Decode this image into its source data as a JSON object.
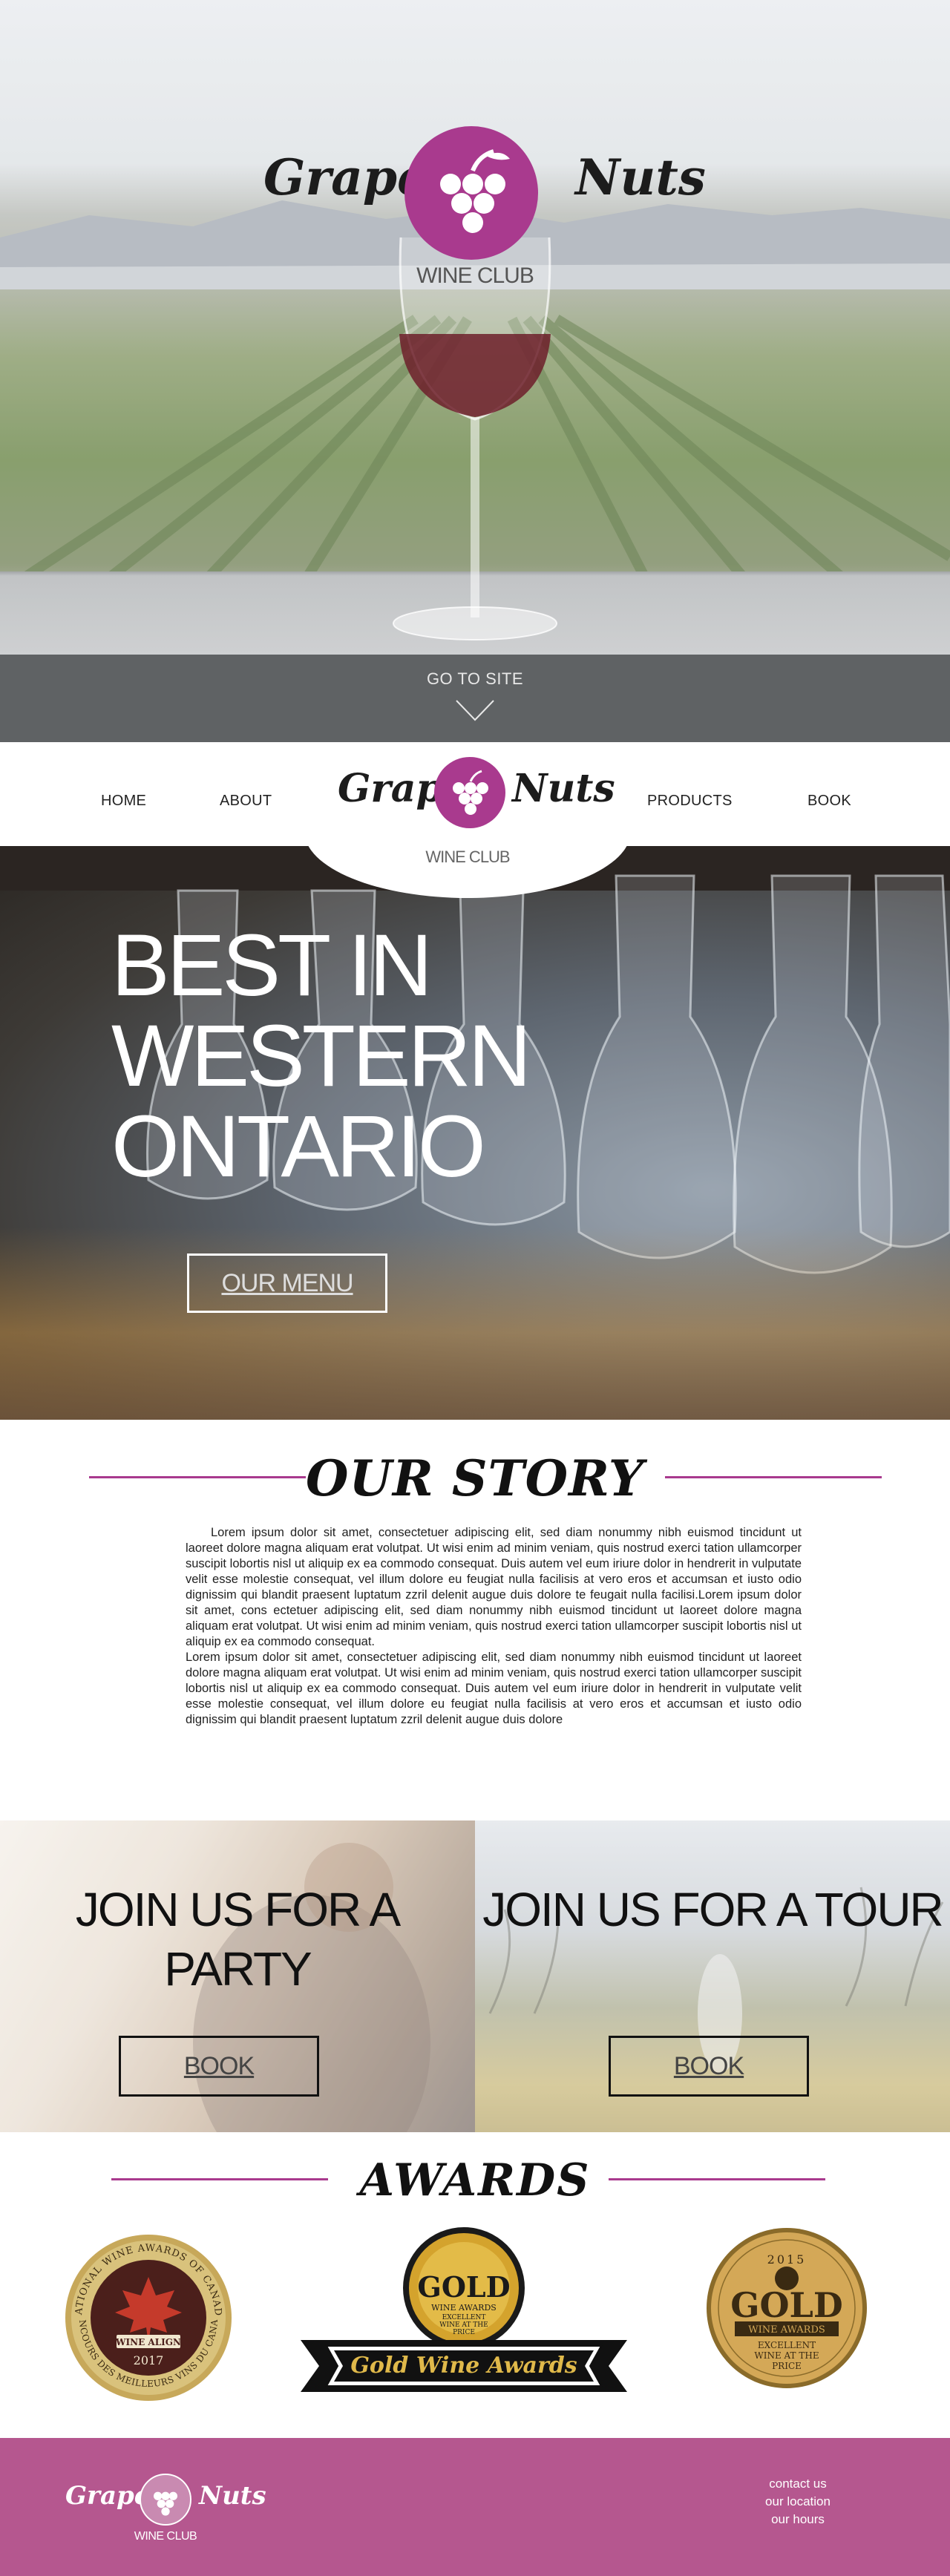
{
  "hero": {
    "brand_left": "Grape",
    "brand_right": "Nuts",
    "brand_sub": "WINE CLUB",
    "goto_label": "GO TO SITE"
  },
  "nav": {
    "items": [
      {
        "label": "HOME"
      },
      {
        "label": "ABOUT"
      },
      {
        "label": "PRODUCTS"
      },
      {
        "label": "BOOK"
      }
    ],
    "brand_left": "Grape",
    "brand_right": "Nuts",
    "brand_sub": "WINE CLUB"
  },
  "bar_hero": {
    "headline": "BEST IN WESTERN ONTARIO",
    "menu_button": "OUR MENU"
  },
  "story": {
    "title": "OUR STORY",
    "paragraph1": "Lorem ipsum dolor sit amet, consectetuer adipiscing elit, sed diam nonummy nibh euismod tincidunt ut laoreet dolore magna aliquam erat volutpat. Ut wisi enim ad minim veniam, quis nostrud exerci tation ullamcorper suscipit lobortis nisl ut aliquip ex ea commodo consequat. Duis autem vel eum iriure dolor in hendrerit in vulputate velit esse molestie consequat, vel illum dolore eu feugiat nulla facilisis at vero eros et accumsan et iusto odio dignissim qui blandit praesent luptatum zzril delenit augue duis dolore te feugait nulla facilisi.Lorem ipsum dolor sit amet, cons ectetuer adipiscing elit, sed diam nonummy nibh euismod tincidunt ut laoreet dolore magna aliquam erat volutpat. Ut wisi enim ad minim veniam, quis nostrud exerci tation ullamcorper suscipit lobortis nisl ut aliquip ex ea commodo consequat.",
    "paragraph2": "Lorem ipsum dolor sit amet, consectetuer adipiscing elit, sed diam nonummy nibh euismod tincidunt ut laoreet dolore magna aliquam erat volutpat. Ut wisi enim ad minim veniam, quis nostrud exerci tation ullamcorper suscipit lobortis nisl ut aliquip ex ea commodo consequat. Duis autem vel eum iriure dolor in hendrerit in vulputate velit esse molestie consequat, vel illum dolore eu feugiat nulla facilisis at vero eros et accumsan et iusto odio dignissim qui blandit praesent luptatum zzril delenit augue duis dolore"
  },
  "join": {
    "party_heading": "JOIN US FOR A PARTY",
    "party_button": "BOOK",
    "tour_heading": "JOIN US FOR A TOUR",
    "tour_button": "BOOK"
  },
  "awards": {
    "title": "AWARDS",
    "badge1": {
      "arc_top": "NATIONAL WINE AWARDS OF CANADA",
      "arc_bottom": "CONCOURS DES MEILLEURS VINS DU CANADA",
      "brand": "WINE ALIGN",
      "year": "2017"
    },
    "badge2": {
      "gold": "GOLD",
      "line1": "WINE AWARDS",
      "line2": "EXCELLENT",
      "line3": "WINE AT THE",
      "line4": "PRICE",
      "ribbon": "Gold Wine Awards"
    },
    "badge3": {
      "year": "2015",
      "gold": "GOLD",
      "line1": "WINE AWARDS",
      "line2": "EXCELLENT",
      "line3": "WINE AT THE",
      "line4": "PRICE"
    }
  },
  "footer": {
    "brand_left": "Grape",
    "brand_right": "Nuts",
    "brand_sub": "WINE CLUB",
    "links": [
      {
        "label": "contact us"
      },
      {
        "label": "our location"
      },
      {
        "label": "our hours"
      }
    ]
  },
  "colors": {
    "brand_purple": "#a93a8e",
    "footer_bg": "#b5578f",
    "goto_bar": "#5f6264"
  }
}
